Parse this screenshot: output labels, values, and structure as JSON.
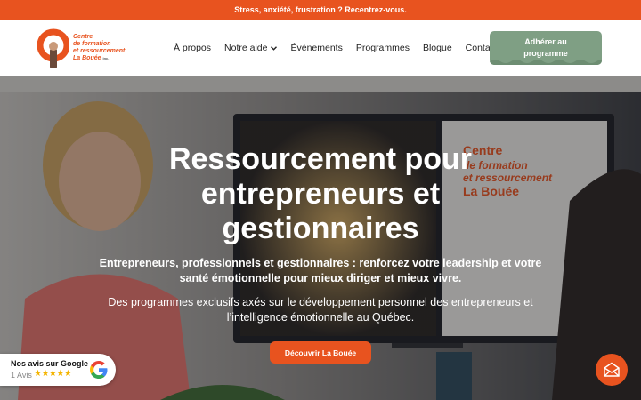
{
  "topbar": {
    "text": "Stress, anxiété, frustration ? Recentrez-vous."
  },
  "logo": {
    "line1": "Centre",
    "line2": "de formation",
    "line3": "et ressourcement",
    "line4": "La Bouée",
    "suffix": "inc."
  },
  "nav": {
    "items": [
      {
        "label": "À propos"
      },
      {
        "label": "Notre aide",
        "has_dropdown": true
      },
      {
        "label": "Événements"
      },
      {
        "label": "Programmes"
      },
      {
        "label": "Blogue"
      },
      {
        "label": "Contact"
      }
    ]
  },
  "cta": {
    "line1": "Adhérer au",
    "line2": "programme"
  },
  "hero": {
    "title": "Ressourcement pour entrepreneurs et gestionnaires",
    "subtitle": "Entrepreneurs, professionnels et gestionnaires : renforcez votre leadership et votre santé émotionnelle pour mieux diriger et mieux vivre.",
    "description": "Des programmes exclusifs axés sur le développement personnel des entrepreneurs et l’intelligence émotionnelle au Québec.",
    "button": "Découvrir La Bouée"
  },
  "reviews": {
    "title": "Nos avis sur Google",
    "count": "1 Avis",
    "stars": "★★★★★",
    "rating": 5
  },
  "icons": {
    "mail": "mail-icon",
    "google": "google-icon",
    "chevron": "chevron-down-icon"
  },
  "colors": {
    "accent": "#e8531f",
    "cta_green": "#7f9f84",
    "star": "#f4b400"
  }
}
